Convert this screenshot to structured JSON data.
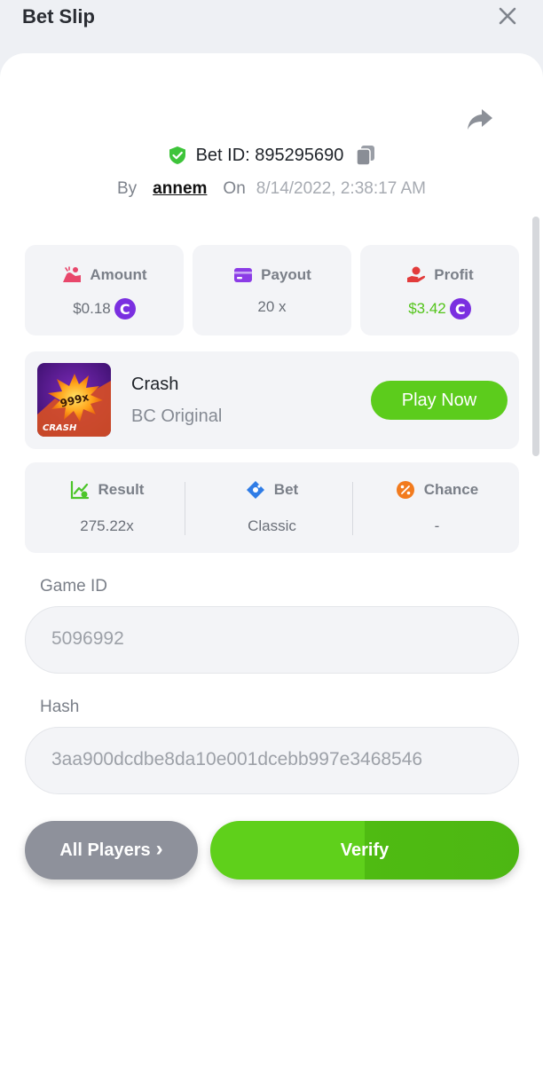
{
  "header": {
    "title": "Bet Slip"
  },
  "bet": {
    "id_text": "Bet ID: 895295690",
    "by_label": "By",
    "user": "annem",
    "on_label": "On",
    "date": "8/14/2022, 2:38:17 AM"
  },
  "stats": {
    "amount": {
      "label": "Amount",
      "value": "$0.18",
      "coin": "C"
    },
    "payout": {
      "label": "Payout",
      "value": "20 x"
    },
    "profit": {
      "label": "Profit",
      "value": "$3.42",
      "coin": "C"
    }
  },
  "game": {
    "name": "Crash",
    "subtitle": "BC Original",
    "play_label": "Play Now",
    "thumb_badge": "999x",
    "thumb_caption": "CRASH"
  },
  "details": {
    "result": {
      "label": "Result",
      "value": "275.22x"
    },
    "bet": {
      "label": "Bet",
      "value": "Classic"
    },
    "chance": {
      "label": "Chance",
      "value": "-"
    }
  },
  "fields": {
    "game_id": {
      "label": "Game ID",
      "value": "5096992"
    },
    "hash": {
      "label": "Hash",
      "value": "3aa900dcdbe8da10e001dcebb997e3468546"
    }
  },
  "actions": {
    "all_players": "All Players",
    "all_players_chevron": "›",
    "verify": "Verify"
  },
  "colors": {
    "accent_green": "#5ccc1c",
    "coin_purple": "#7a2fe0",
    "profit_green": "#53c41a"
  },
  "icons": [
    "close-icon",
    "share-icon",
    "shield-check-icon",
    "copy-icon",
    "amount-icon",
    "payout-card-icon",
    "profit-hand-icon",
    "result-chart-icon",
    "bet-tag-icon",
    "chance-percent-icon"
  ]
}
